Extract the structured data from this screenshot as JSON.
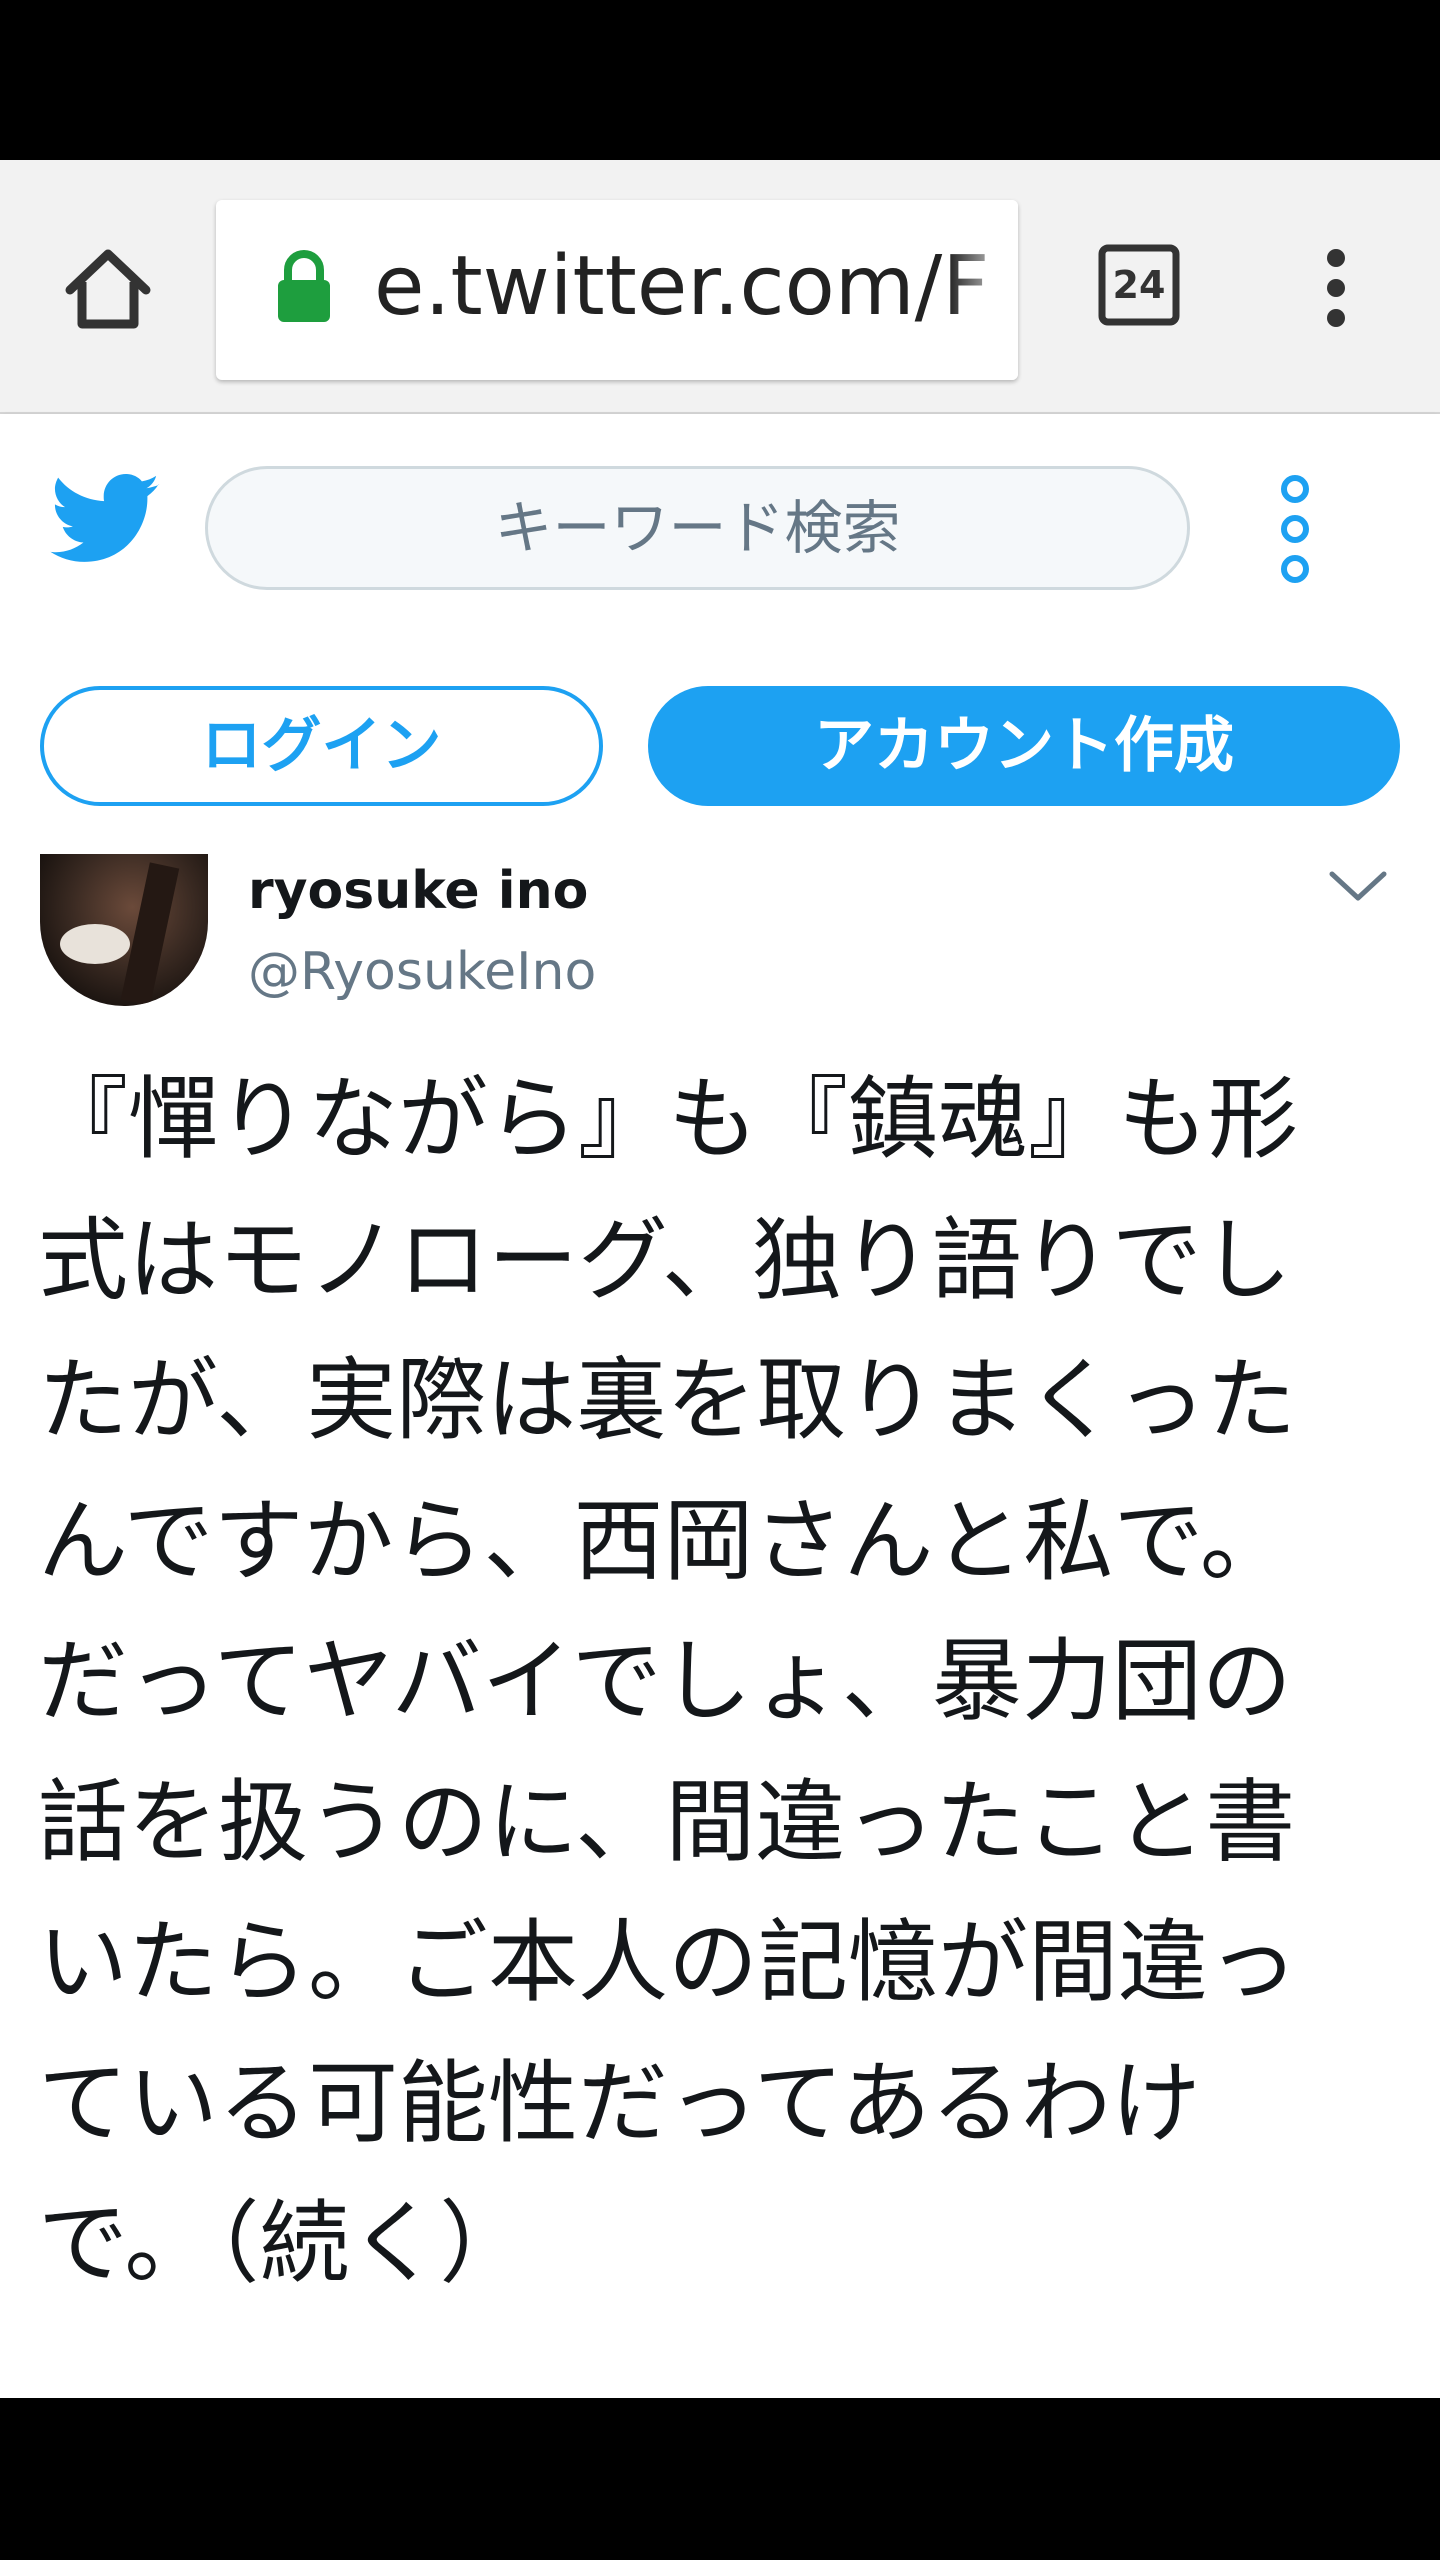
{
  "browser": {
    "url": "e.twitter.com/F",
    "tab_count": "24",
    "icons": {
      "home": "home-icon",
      "lock": "lock-icon",
      "tabs": "tabs-icon",
      "menu": "more-vert-icon"
    },
    "colors": {
      "lock": "#1e9e3e",
      "toolbar_bg": "#f2f2f2"
    }
  },
  "twitter_header": {
    "search_placeholder": "キーワード検索",
    "login_label": "ログイン",
    "signup_label": "アカウント作成",
    "colors": {
      "brand": "#1da1f2"
    }
  },
  "tweet": {
    "display_name": "ryosuke ino",
    "handle": "@RyosukeIno",
    "text_lines": [
      "『憚りながら』も『鎮魂』も形",
      "式はモノローグ、独り語りでし",
      "たが、実際は裏を取りまくった",
      "んですから、西岡さんと私で。",
      "だってヤバイでしょ、暴力団の",
      "話を扱うのに、間違ったこと書",
      "いたら。ご本人の記憶が間違っ",
      "ている可能性だってあるわけ",
      "で。（続く）"
    ]
  }
}
